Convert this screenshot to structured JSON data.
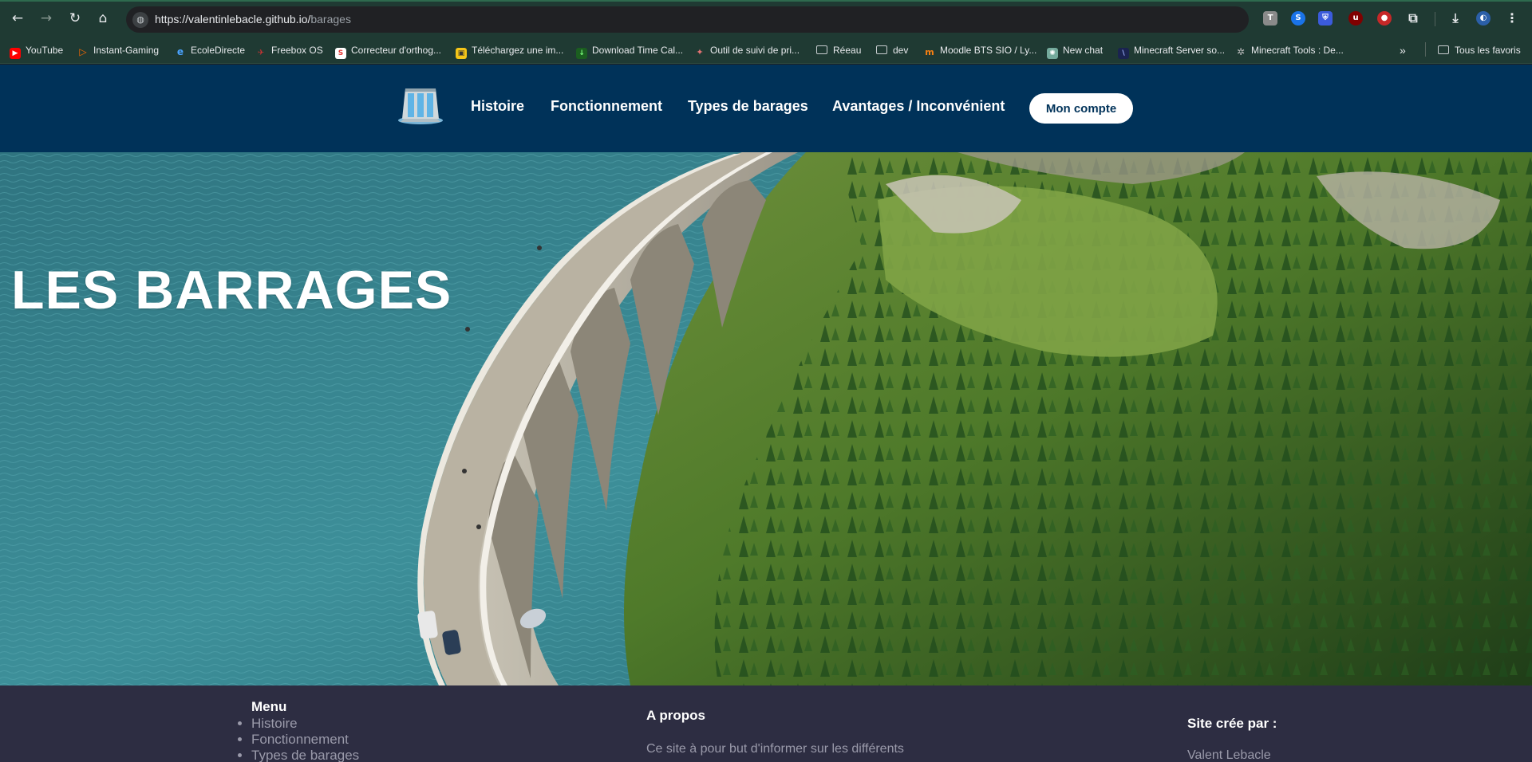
{
  "browser": {
    "url_host": "https://valentinlebacle.github.io/",
    "url_path": "barages",
    "bookmarks": [
      {
        "label": "YouTube",
        "icon": "youtube-icon",
        "color": "#ff0000"
      },
      {
        "label": "Instant-Gaming",
        "icon": "instant-gaming-icon",
        "color": "#ff6a00"
      },
      {
        "label": "EcoleDirecte",
        "icon": "ecoledirecte-icon",
        "color": "#1e73be"
      },
      {
        "label": "Freebox OS",
        "icon": "freebox-icon",
        "color": "#cc2222"
      },
      {
        "label": "Correcteur d'orthog...",
        "icon": "scribens-icon",
        "color": "#e53935"
      },
      {
        "label": "Téléchargez une im...",
        "icon": "download-image-icon",
        "color": "#f5c518"
      },
      {
        "label": "Download Time Cal...",
        "icon": "download-icon",
        "color": "#2e7d32"
      },
      {
        "label": "Outil de suivi de pri...",
        "icon": "price-tracker-icon",
        "color": "#d32f2f"
      },
      {
        "label": "Réeau",
        "icon": "folder-icon",
        "color": "#c8cdd0"
      },
      {
        "label": "dev",
        "icon": "folder-icon",
        "color": "#c8cdd0"
      },
      {
        "label": "Moodle BTS SIO / Ly...",
        "icon": "moodle-icon",
        "color": "#f98012"
      },
      {
        "label": "New chat",
        "icon": "chat-icon",
        "color": "#74aa9c"
      },
      {
        "label": "Minecraft Server so...",
        "icon": "minecraft-server-icon",
        "color": "#3b4b8c"
      },
      {
        "label": "Minecraft Tools : De...",
        "icon": "minecraft-tools-icon",
        "color": "#9e9e9e"
      }
    ],
    "all_bookmarks_label": "Tous les favoris"
  },
  "header": {
    "nav": [
      "Histoire",
      "Fonctionnement",
      "Types de barages",
      "Avantages / Inconvénient"
    ],
    "account_label": "Mon compte"
  },
  "hero": {
    "title": "LES BARRAGES"
  },
  "footer": {
    "menu_heading": "Menu",
    "menu_items": [
      "Histoire",
      "Fonctionnement",
      "Types de barages"
    ],
    "about_heading": "A propos",
    "about_text": "Ce site à pour but d'informer sur les différents",
    "credits_heading": "Site crée par :",
    "credits_name": "Valent Lebacle"
  },
  "colors": {
    "header_bg": "#003259",
    "footer_bg": "#2d2d42",
    "browser_chrome": "#1f3a33"
  }
}
